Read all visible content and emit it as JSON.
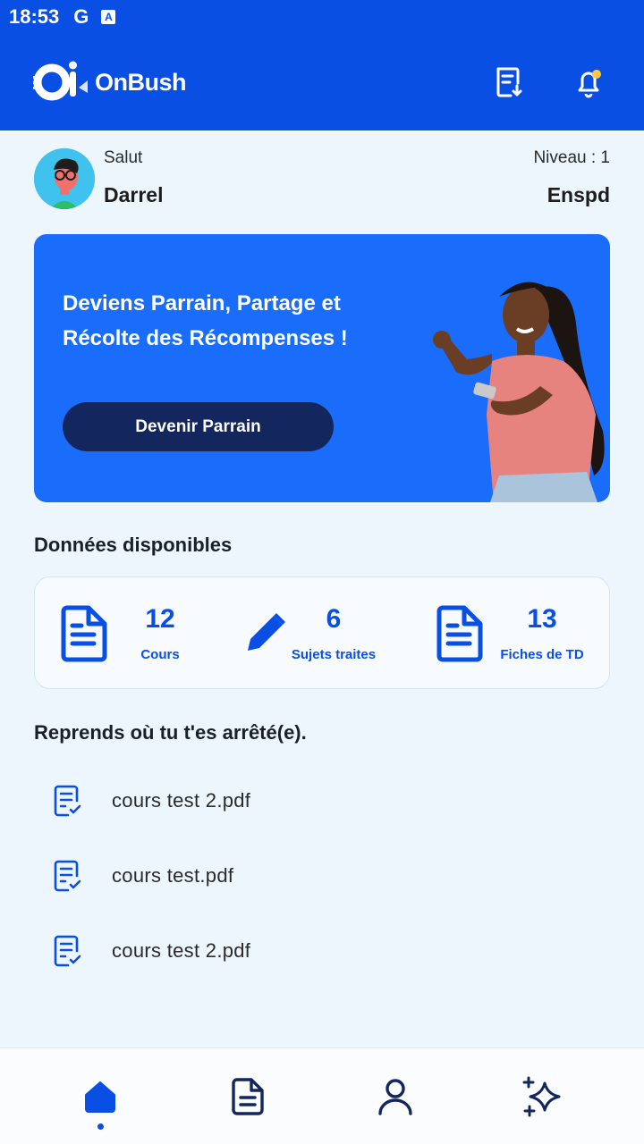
{
  "status_bar": {
    "time": "18:53",
    "g_label": "G",
    "a_label": "A"
  },
  "app": {
    "name": "OnBush"
  },
  "greeting": {
    "salutation": "Salut",
    "user_name": "Darrel",
    "level": "Niveau : 1",
    "school": "Enspd"
  },
  "banner": {
    "text": "Deviens Parrain, Partage et Récolte des Récompenses !",
    "button_label": "Devenir Parrain"
  },
  "data_section": {
    "title": "Données disponibles",
    "stats": [
      {
        "value": "12",
        "label": "Cours",
        "icon": "document-icon"
      },
      {
        "value": "6",
        "label": "Sujets traites",
        "icon": "pencil-icon"
      },
      {
        "value": "13",
        "label": "Fiches de TD",
        "icon": "document-icon"
      }
    ]
  },
  "recent": {
    "title": "Reprends où tu t'es arrêté(e).",
    "items": [
      {
        "label": "cours test 2.pdf"
      },
      {
        "label": "cours test.pdf"
      },
      {
        "label": "cours test 2.pdf"
      }
    ]
  },
  "nav": {
    "items": [
      "home-icon",
      "documents-icon",
      "profile-icon",
      "sparkles-icon"
    ],
    "active_index": 0
  },
  "colors": {
    "primary": "#0a4fe4",
    "banner": "#1a6dfb",
    "button_dark": "#13275e",
    "notif_dot": "#ffc83d"
  }
}
